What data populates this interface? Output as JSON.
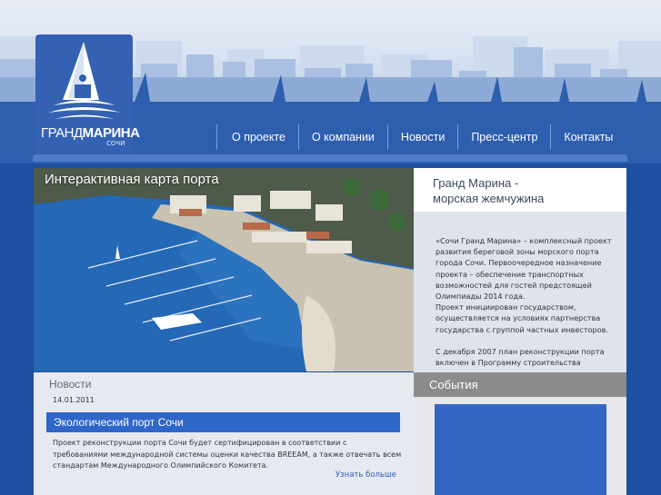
{
  "logo": {
    "brand_light": "ГРАНД",
    "brand_bold": "МАРИНА",
    "city": "СОЧИ"
  },
  "nav": {
    "items": [
      "О проекте",
      "О компании",
      "Новости",
      "Пресс-центр",
      "Контакты"
    ]
  },
  "map": {
    "title": "Интерактивная карта порта"
  },
  "info": {
    "title_line1": "Гранд Марина -",
    "title_line2": "морская жемчужина",
    "para1": "«Сочи Гранд Марина» – комплексный проект развития береговой зоны морского порта города Сочи. Первоочередное назначение проекта – обеспечение транспортных возможностей для гостей предстоящей Олимпиады 2014 года.",
    "para2": "Проект инициирован государством, осуществляется на условиях партнерства государства с группой частных инвесторов.",
    "para3": "С декабря 2007 план реконструкции порта включен в Программу строительства"
  },
  "events": {
    "title": "События"
  },
  "news": {
    "title": "Новости",
    "date": "14.01.2011",
    "headline": "Экологический порт Сочи",
    "text": "Проект реконструкции порта Сочи будет сертифицирован в соответствии с требованиями международной системы оценки качества BREEAM, а также отвечать всем стандартам Международного Олимпийского Комитета.",
    "more": "Узнать больше"
  },
  "colors": {
    "primary": "#1f4fa0",
    "accent": "#2f66c8",
    "events_header": "#8c8c8c"
  }
}
